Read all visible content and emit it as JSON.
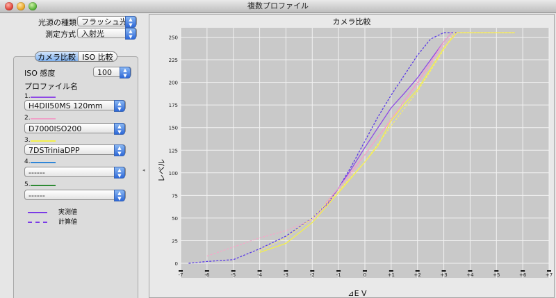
{
  "window": {
    "title": "複数プロファイル"
  },
  "controls": {
    "light_source_label": "光源の種類",
    "light_source_value": "フラッシュ光",
    "metering_label": "測定方式",
    "metering_value": "入射光"
  },
  "tabs": [
    {
      "label": "カメラ比較",
      "selected": true
    },
    {
      "label": "ISO 比較",
      "selected": false
    }
  ],
  "iso": {
    "label": "ISO 感度",
    "value": "100"
  },
  "profiles": {
    "heading": "プロファイル名",
    "items": [
      {
        "number": "1.",
        "color": "#8e48e6",
        "value": "H4DII50MS 120mm"
      },
      {
        "number": "2.",
        "color": "#f0a0c8",
        "value": "D7000ISO200"
      },
      {
        "number": "3.",
        "color": "#f4f04a",
        "value": "7DSTriniaDPP"
      },
      {
        "number": "4.",
        "color": "#2f86d8",
        "value": "------"
      },
      {
        "number": "5.",
        "color": "#2e8a34",
        "value": "------"
      }
    ]
  },
  "legend": {
    "measured_label": "実測値",
    "calculated_label": "計算値",
    "color": "#7a3be6"
  },
  "chart": {
    "title": "カメラ比較",
    "ylabel": "レベル",
    "xlabel": "⊿E V"
  },
  "chart_data": {
    "type": "line",
    "title": "カメラ比較",
    "xlabel": "⊿E V",
    "ylabel": "レベル",
    "xlim": [
      -7,
      7
    ],
    "ylim": [
      0,
      255
    ],
    "x_ticks": [
      "-7",
      "-6",
      "-5",
      "-4",
      "-3",
      "-2",
      "-1",
      "0",
      "+1",
      "+2",
      "+3",
      "+4",
      "+5",
      "+6",
      "+7"
    ],
    "x_tick_values": [
      -7,
      -6,
      -5,
      -4,
      -3,
      -2,
      -1,
      0,
      1,
      2,
      3,
      4,
      5,
      6,
      7
    ],
    "y_ticks": [
      0,
      25,
      50,
      75,
      100,
      125,
      150,
      175,
      200,
      225,
      250
    ],
    "grid": true,
    "series": [
      {
        "name": "H4DII50MS 120mm",
        "style": "solid",
        "color": "#8e48e6",
        "points": [
          [
            -1.5,
            62
          ],
          [
            -1,
            83
          ],
          [
            -0.5,
            105
          ],
          [
            0,
            128
          ],
          [
            0.5,
            150
          ],
          [
            1,
            172
          ],
          [
            1.5,
            188
          ],
          [
            2,
            205
          ],
          [
            2.5,
            225
          ],
          [
            3,
            245
          ],
          [
            3.3,
            255
          ]
        ]
      },
      {
        "name": "H4DII50MS 120mm",
        "style": "dashed",
        "color": "#5a3be6",
        "points": [
          [
            -6.7,
            0
          ],
          [
            -6,
            2
          ],
          [
            -5,
            4
          ],
          [
            -4.5,
            10
          ],
          [
            -4,
            16
          ],
          [
            -3,
            30
          ],
          [
            -2,
            50
          ],
          [
            -1.5,
            64
          ],
          [
            -1,
            83
          ],
          [
            -0.5,
            108
          ],
          [
            0,
            135
          ],
          [
            0.5,
            162
          ],
          [
            1,
            186
          ],
          [
            1.5,
            208
          ],
          [
            2,
            230
          ],
          [
            2.5,
            248
          ],
          [
            3,
            255
          ],
          [
            3.6,
            255
          ]
        ]
      },
      {
        "name": "D7000ISO200",
        "style": "solid",
        "color": "#f0a0c8",
        "points": [
          [
            -1.5,
            66
          ],
          [
            -1,
            83
          ],
          [
            -0.5,
            102
          ],
          [
            0,
            120
          ],
          [
            0.5,
            140
          ],
          [
            1,
            158
          ],
          [
            1.5,
            180
          ],
          [
            2,
            200
          ],
          [
            2.5,
            222
          ],
          [
            3,
            245
          ],
          [
            3.3,
            255
          ]
        ]
      },
      {
        "name": "D7000ISO200",
        "style": "dashed",
        "color": "#f4a8c8",
        "points": [
          [
            -6,
            8
          ],
          [
            -5,
            18
          ],
          [
            -4,
            28
          ],
          [
            -3,
            36
          ],
          [
            -2,
            48
          ],
          [
            -1,
            78
          ],
          [
            0,
            120
          ],
          [
            1,
            160
          ],
          [
            2,
            198
          ],
          [
            2.5,
            220
          ],
          [
            3,
            242
          ],
          [
            3.5,
            255
          ],
          [
            5.7,
            255
          ]
        ]
      },
      {
        "name": "7DSTriniaDPP",
        "style": "solid",
        "color": "#f4f04a",
        "points": [
          [
            -4,
            12
          ],
          [
            -3,
            22
          ],
          [
            -2,
            45
          ],
          [
            -1,
            78
          ],
          [
            0,
            112
          ],
          [
            0.5,
            130
          ],
          [
            1,
            158
          ],
          [
            1.5,
            176
          ],
          [
            2,
            192
          ],
          [
            2.5,
            215
          ],
          [
            3,
            238
          ],
          [
            3.5,
            255
          ],
          [
            5.7,
            255
          ]
        ]
      },
      {
        "name": "7DSTriniaDPP",
        "style": "dashed",
        "color": "#f6ee6a",
        "points": [
          [
            -4,
            14
          ],
          [
            -3,
            28
          ],
          [
            -2,
            50
          ],
          [
            -1,
            80
          ],
          [
            0,
            112
          ],
          [
            1,
            152
          ],
          [
            2,
            190
          ],
          [
            3,
            236
          ],
          [
            3.4,
            255
          ],
          [
            5.7,
            255
          ]
        ]
      }
    ]
  }
}
